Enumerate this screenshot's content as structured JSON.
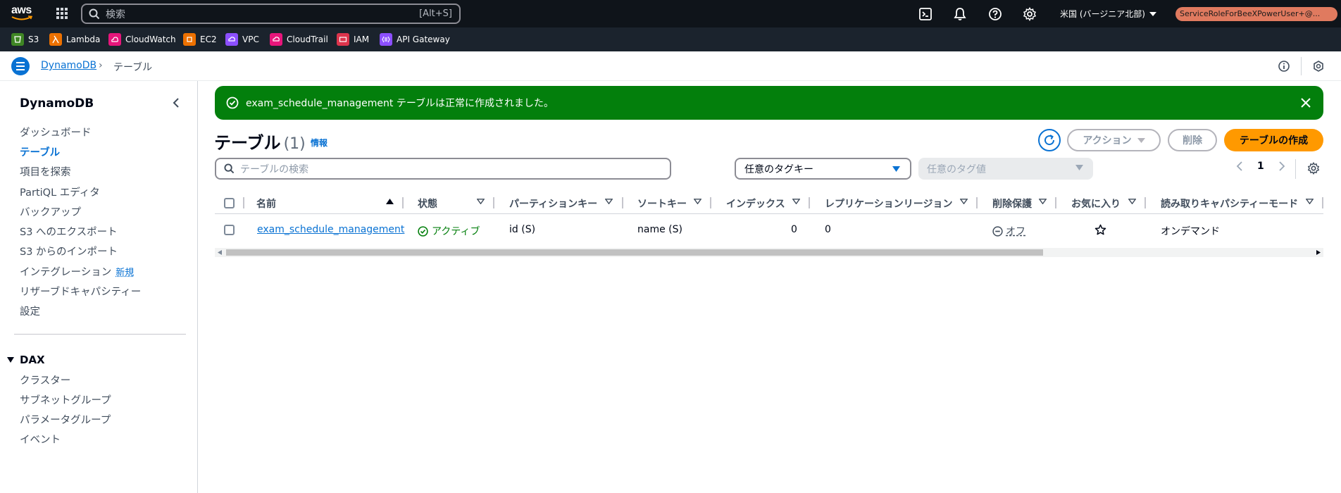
{
  "topnav": {
    "logo_text": "aws",
    "search_placeholder": "検索",
    "search_shortcut": "[Alt+S]",
    "region": "米国 (バージニア北部)",
    "role": "ServiceRoleForBeeXPowerUser+@..."
  },
  "services": [
    {
      "label": "S3",
      "icon": "s3-icon",
      "color": "#3f8624"
    },
    {
      "label": "Lambda",
      "icon": "lambda-icon",
      "color": "#ed7100"
    },
    {
      "label": "CloudWatch",
      "icon": "cloudwatch-icon",
      "color": "#e7157b"
    },
    {
      "label": "EC2",
      "icon": "ec2-icon",
      "color": "#ed7100"
    },
    {
      "label": "VPC",
      "icon": "vpc-icon",
      "color": "#8c4fff"
    },
    {
      "label": "CloudTrail",
      "icon": "cloudtrail-icon",
      "color": "#e7157b"
    },
    {
      "label": "IAM",
      "icon": "iam-icon",
      "color": "#dd344c"
    },
    {
      "label": "API Gateway",
      "icon": "api-gateway-icon",
      "color": "#8c4fff"
    }
  ],
  "breadcrumb": {
    "root": "DynamoDB",
    "current": "テーブル"
  },
  "sidebar": {
    "title": "DynamoDB",
    "items": [
      {
        "label": "ダッシュボード"
      },
      {
        "label": "テーブル",
        "active": true
      },
      {
        "label": "項目を探索"
      },
      {
        "label": "PartiQL エディタ"
      },
      {
        "label": "バックアップ"
      },
      {
        "label": "S3 へのエクスポート"
      },
      {
        "label": "S3 からのインポート"
      },
      {
        "label": "インテグレーション",
        "badge": "新規"
      },
      {
        "label": "リザーブドキャパシティー"
      },
      {
        "label": "設定"
      }
    ],
    "dax": {
      "title": "DAX",
      "items": [
        {
          "label": "クラスター"
        },
        {
          "label": "サブネットグループ"
        },
        {
          "label": "パラメータグループ"
        },
        {
          "label": "イベント"
        }
      ]
    }
  },
  "flash": {
    "message": "exam_schedule_management テーブルは正常に作成されました。"
  },
  "header": {
    "title": "テーブル",
    "count": "(1)",
    "info": "情報",
    "actions_label": "アクション",
    "delete_label": "削除",
    "create_label": "テーブルの作成"
  },
  "filters": {
    "search_placeholder": "テーブルの検索",
    "tag_key": "任意のタグキー",
    "tag_value": "任意のタグ値",
    "page": "1"
  },
  "table": {
    "columns": [
      "名前",
      "状態",
      "パーティションキー",
      "ソートキー",
      "インデックス",
      "レプリケーションリージョン",
      "削除保護",
      "お気に入り",
      "読み取りキャパシティーモード"
    ],
    "rows": [
      {
        "name": "exam_schedule_management",
        "status": "アクティブ",
        "partition_key": "id (S)",
        "sort_key": "name (S)",
        "indexes": "0",
        "replication": "0",
        "deletion_protection": "オフ",
        "capacity_mode": "オンデマンド"
      }
    ]
  },
  "colors": {
    "topnav_bg": "#0f141a",
    "link": "#0972d3",
    "success": "#037f0c",
    "primary_button": "#ff9900",
    "role_badge": "#e07a5f"
  }
}
